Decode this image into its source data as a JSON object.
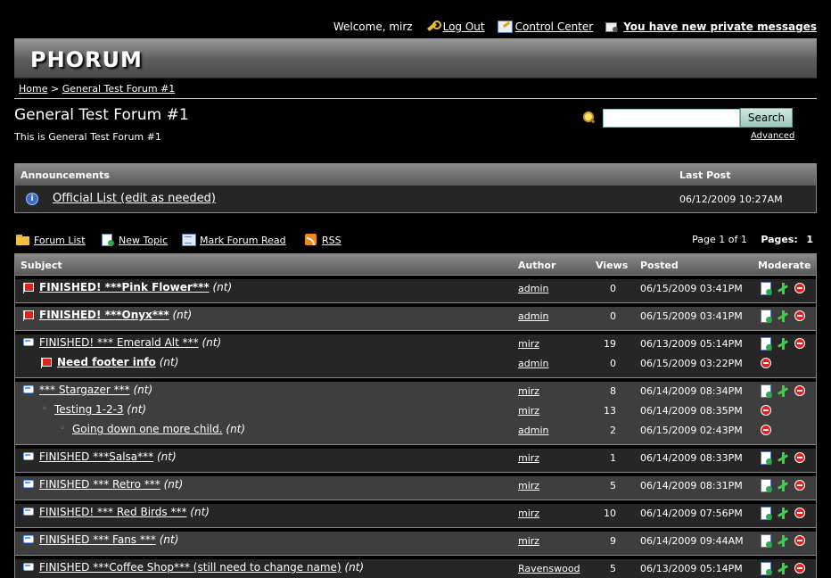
{
  "userbar": {
    "welcome": "Welcome, mirz",
    "logout": "Log Out",
    "control_center": "Control Center",
    "private_messages": "You have new private messages"
  },
  "logo": "PHORUM",
  "breadcrumb": {
    "home": "Home",
    "sep": ">",
    "forum": "General Test Forum #1"
  },
  "forum": {
    "title": "General Test Forum #1",
    "description": "This is General Test Forum #1"
  },
  "search": {
    "value": "",
    "button": "Search",
    "advanced": "Advanced"
  },
  "announcements": {
    "header": "Announcements",
    "last_post_header": "Last Post",
    "items": [
      {
        "title": "Official List (edit as needed)",
        "last_post": "06/12/2009 10:27AM"
      }
    ]
  },
  "toolbar": {
    "forum_list": "Forum List",
    "new_topic": "New Topic",
    "mark_read": "Mark Forum Read",
    "rss": "RSS",
    "page_info": "Page 1 of 1",
    "pages_label": "Pages:",
    "page_current": "1"
  },
  "table": {
    "headers": {
      "subject": "Subject",
      "author": "Author",
      "views": "Views",
      "posted": "Posted",
      "moderate": "Moderate"
    },
    "groups": [
      {
        "rows": [
          {
            "icon": "flag-icon",
            "indent": 0,
            "bold": true,
            "subject": "FINISHED! ***Pink Flower***",
            "nt": "(nt)",
            "author": "admin",
            "views": "0",
            "posted": "06/15/2009 03:41PM",
            "mod": "full"
          }
        ]
      },
      {
        "rows": [
          {
            "icon": "flag-icon",
            "indent": 0,
            "bold": true,
            "subject": "FINISHED! ***Onyx***",
            "nt": "(nt)",
            "author": "admin",
            "views": "0",
            "posted": "06/15/2009 03:41PM",
            "mod": "full"
          }
        ]
      },
      {
        "rows": [
          {
            "icon": "bubble-icon",
            "indent": 0,
            "bold": false,
            "subject": "FINISHED! *** Emerald Alt ***",
            "nt": "(nt)",
            "author": "mirz",
            "views": "19",
            "posted": "06/13/2009 05:14PM",
            "mod": "full"
          },
          {
            "icon": "flag-icon",
            "indent": 1,
            "bold": true,
            "subject": "Need footer info",
            "nt": "(nt)",
            "author": "admin",
            "views": "0",
            "posted": "06/15/2009 03:22PM",
            "mod": "delete"
          }
        ]
      },
      {
        "rows": [
          {
            "icon": "bubble-icon",
            "indent": 0,
            "bold": false,
            "subject": "*** Stargazer ***",
            "nt": "(nt)",
            "author": "mirz",
            "views": "8",
            "posted": "06/14/2009 08:34PM",
            "mod": "full"
          },
          {
            "icon": "dot-icon",
            "indent": 1,
            "bold": false,
            "subject": "Testing 1-2-3",
            "nt": "(nt)",
            "author": "mirz",
            "views": "13",
            "posted": "06/14/2009 08:35PM",
            "mod": "delete"
          },
          {
            "icon": "dot-icon",
            "indent": 2,
            "bold": false,
            "subject": "Going down one more child.",
            "nt": "(nt)",
            "author": "admin",
            "views": "2",
            "posted": "06/15/2009 02:43PM",
            "mod": "delete"
          }
        ]
      },
      {
        "rows": [
          {
            "icon": "bubble-icon",
            "indent": 0,
            "bold": false,
            "subject": "FINISHED ***Salsa***",
            "nt": "(nt)",
            "author": "mirz",
            "views": "1",
            "posted": "06/14/2009 08:33PM",
            "mod": "full"
          }
        ]
      },
      {
        "rows": [
          {
            "icon": "bubble-icon",
            "indent": 0,
            "bold": false,
            "subject": "FINISHED *** Retro ***",
            "nt": "(nt)",
            "author": "mirz",
            "views": "5",
            "posted": "06/14/2009 08:31PM",
            "mod": "full"
          }
        ]
      },
      {
        "rows": [
          {
            "icon": "bubble-icon",
            "indent": 0,
            "bold": false,
            "subject": "FINISHED! *** Red Birds ***",
            "nt": "(nt)",
            "author": "mirz",
            "views": "10",
            "posted": "06/14/2009 07:56PM",
            "mod": "full"
          }
        ]
      },
      {
        "rows": [
          {
            "icon": "bubble-icon",
            "indent": 0,
            "bold": false,
            "subject": "FINISHED *** Fans ***",
            "nt": "(nt)",
            "author": "mirz",
            "views": "9",
            "posted": "06/14/2009 09:44AM",
            "mod": "full"
          }
        ]
      },
      {
        "rows": [
          {
            "icon": "bubble-icon",
            "indent": 0,
            "bold": false,
            "subject": "FINISHED ***Coffee Shop*** (still need to change name)",
            "nt": "(nt)",
            "author": "Ravenswood",
            "views": "5",
            "posted": "06/13/2009 05:14PM",
            "mod": "full"
          }
        ]
      }
    ]
  },
  "colors": {
    "background": "#000000",
    "row_dark": "#262626",
    "row_light": "#3e3e3e",
    "delete": "#e02020",
    "flag": "#d22222"
  }
}
